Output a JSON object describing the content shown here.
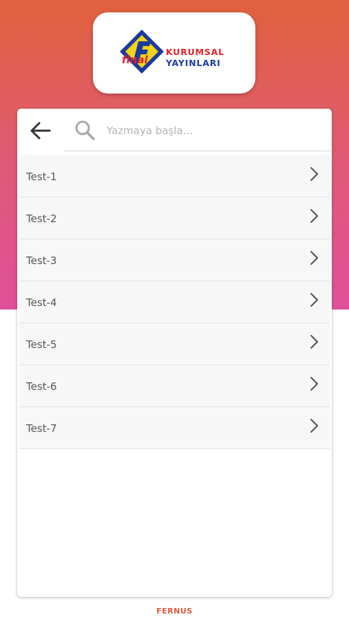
{
  "logo": {
    "mark_text": "final",
    "line1": "KURUMSAL",
    "line2": "YAYINLARI"
  },
  "header": {
    "back_icon": "arrow-left-icon",
    "search": {
      "icon": "search-icon",
      "placeholder": "Yazmaya başla...",
      "value": ""
    }
  },
  "tests": [
    {
      "label": "Test-1"
    },
    {
      "label": "Test-2"
    },
    {
      "label": "Test-3"
    },
    {
      "label": "Test-4"
    },
    {
      "label": "Test-5"
    },
    {
      "label": "Test-6"
    },
    {
      "label": "Test-7"
    }
  ],
  "footer": {
    "brand": "FERNUS"
  },
  "colors": {
    "gradient_top": "#e0613d",
    "gradient_bottom": "#df4f9a",
    "logo_red": "#e3242b",
    "logo_blue": "#1d3b9c",
    "brand_orange": "#e2553b"
  }
}
